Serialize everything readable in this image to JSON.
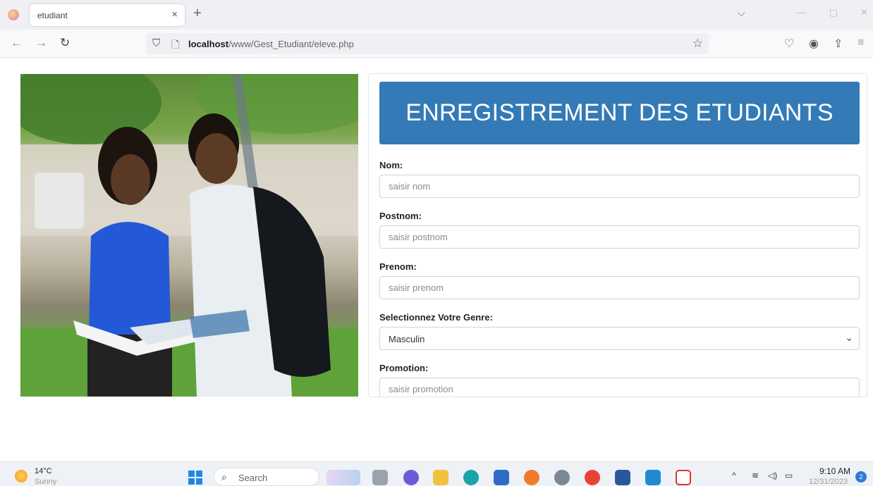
{
  "browser": {
    "tab_title": "etudiant",
    "tab_close": "×",
    "new_tab": "+",
    "url_host": "localhost",
    "url_path": "/www/Gest_Etudiant/eleve.php"
  },
  "form": {
    "banner_title": "ENREGISTREMENT DES ETUDIANTS",
    "nom": {
      "label": "Nom:",
      "placeholder": "saisir nom"
    },
    "postnom": {
      "label": "Postnom:",
      "placeholder": "saisir postnom"
    },
    "prenom": {
      "label": "Prenom:",
      "placeholder": "saisir prenom"
    },
    "genre": {
      "label": "Selectionnez Votre Genre:",
      "selected": "Masculin"
    },
    "promotion": {
      "label": "Promotion:",
      "placeholder": "saisir promotion"
    }
  },
  "taskbar": {
    "weather_temp": "14°C",
    "weather_condition": "Sunny",
    "search_label": "Search",
    "time": "9:10 AM",
    "date": "12/31/2023",
    "notification_count": "2"
  },
  "colors": {
    "banner": "#337ab7",
    "browser_chrome": "#f0f0f4",
    "taskbar": "#eef1f6"
  }
}
